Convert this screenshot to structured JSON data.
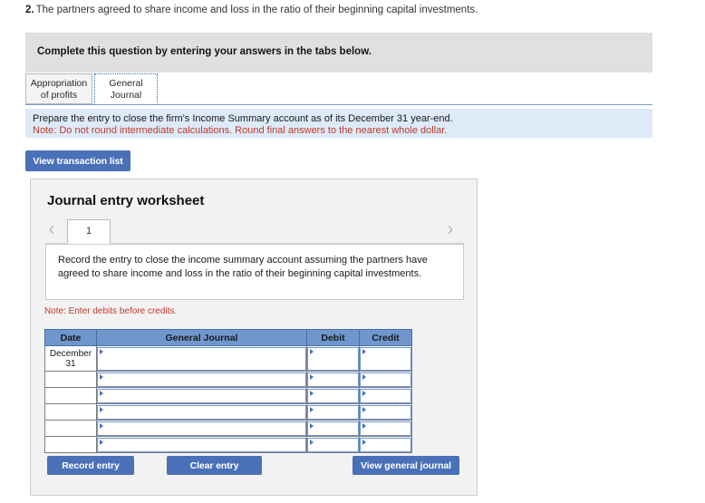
{
  "question": {
    "number": "2.",
    "text": "The partners agreed to share income and loss in the ratio of their beginning capital investments."
  },
  "gray_banner": {
    "text": "Complete this question by entering your answers in the tabs below."
  },
  "tabs": [
    {
      "label_line1": "Appropriation",
      "label_line2": "of profits",
      "active": false
    },
    {
      "label_line1": "General",
      "label_line2": "Journal",
      "active": true
    }
  ],
  "instruction_band": {
    "line1": "Prepare the entry to close the firm's Income Summary account as of its December 31 year-end.",
    "line2": "Note: Do not round intermediate calculations. Round final answers to the nearest whole dollar.",
    "background_color": "#ddeaf7",
    "note_color": "#c0392b"
  },
  "view_transaction_list": {
    "label": "View transaction list"
  },
  "worksheet": {
    "title": "Journal entry worksheet",
    "pager": {
      "prev_icon": "chevron-left-icon",
      "next_icon": "chevron-right-icon",
      "current_page": "1"
    },
    "scenario": "Record the entry to close the income summary account assuming the partners have agreed to share income and loss in the ratio of their beginning capital investments.",
    "debits_note": "Note: Enter debits before credits.",
    "table": {
      "headers": [
        "Date",
        "General Journal",
        "Debit",
        "Credit"
      ],
      "rows": [
        {
          "date": "December 31",
          "journal": "",
          "debit": "",
          "credit": ""
        },
        {
          "date": "",
          "journal": "",
          "debit": "",
          "credit": ""
        },
        {
          "date": "",
          "journal": "",
          "debit": "",
          "credit": ""
        },
        {
          "date": "",
          "journal": "",
          "debit": "",
          "credit": ""
        },
        {
          "date": "",
          "journal": "",
          "debit": "",
          "credit": ""
        },
        {
          "date": "",
          "journal": "",
          "debit": "",
          "credit": ""
        }
      ]
    },
    "buttons": {
      "record_entry": "Record entry",
      "clear_entry": "Clear entry",
      "view_general_journal": "View general journal"
    }
  },
  "colors": {
    "accent_blue": "#4a70b8",
    "table_header_blue": "#6f97ce",
    "gray_banner": "#e0e0e0",
    "card_background": "#f2f2f2"
  }
}
